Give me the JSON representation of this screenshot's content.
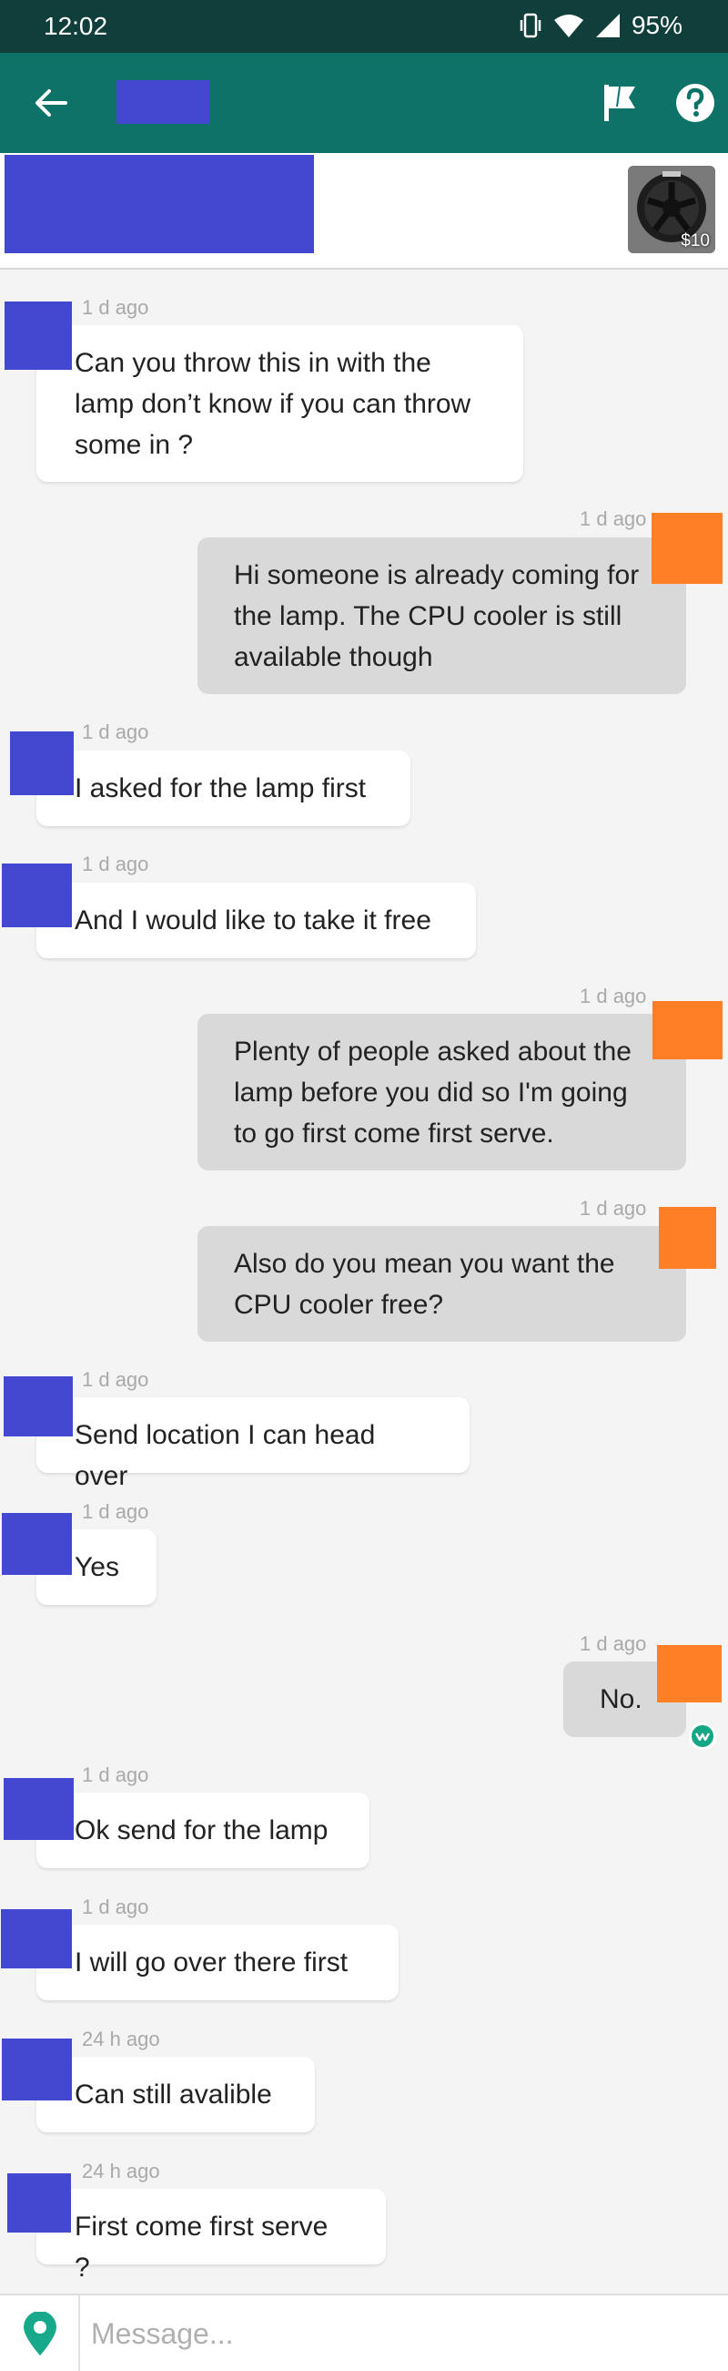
{
  "status_bar": {
    "time": "12:02",
    "battery": "95%"
  },
  "listing": {
    "price": "$10"
  },
  "composer": {
    "placeholder": "Message..."
  },
  "messages": [
    {
      "side": "in",
      "time": "1 d ago",
      "text": "Can you throw this in with the\nlamp don’t know if you can throw\nsome in ?"
    },
    {
      "side": "out",
      "time": "1 d ago",
      "text": "Hi someone is already coming for\nthe lamp. The CPU cooler is still\navailable though"
    },
    {
      "side": "in",
      "time": "1 d ago",
      "text": "I asked for the lamp first"
    },
    {
      "side": "in",
      "time": "1 d ago",
      "text": "And I would like to take it free"
    },
    {
      "side": "out",
      "time": "1 d ago",
      "text": "Plenty of people asked about the\nlamp before you did so I'm going\nto go first come first serve."
    },
    {
      "side": "out",
      "time": "1 d ago",
      "text": "Also do you mean you want the\nCPU cooler free?"
    },
    {
      "side": "in",
      "time": "1 d ago",
      "text": "Send location I can head over"
    },
    {
      "side": "in",
      "time": "1 d ago",
      "text": "Yes"
    },
    {
      "side": "out",
      "time": "1 d ago",
      "text": "No.",
      "read": true
    },
    {
      "side": "in",
      "time": "1 d ago",
      "text": "Ok send for the lamp"
    },
    {
      "side": "in",
      "time": "1 d ago",
      "text": "I will go over there first"
    },
    {
      "side": "in",
      "time": "24 h ago",
      "text": "Can still avalible"
    },
    {
      "side": "in",
      "time": "24 h ago",
      "text": "First come first serve ?"
    }
  ]
}
